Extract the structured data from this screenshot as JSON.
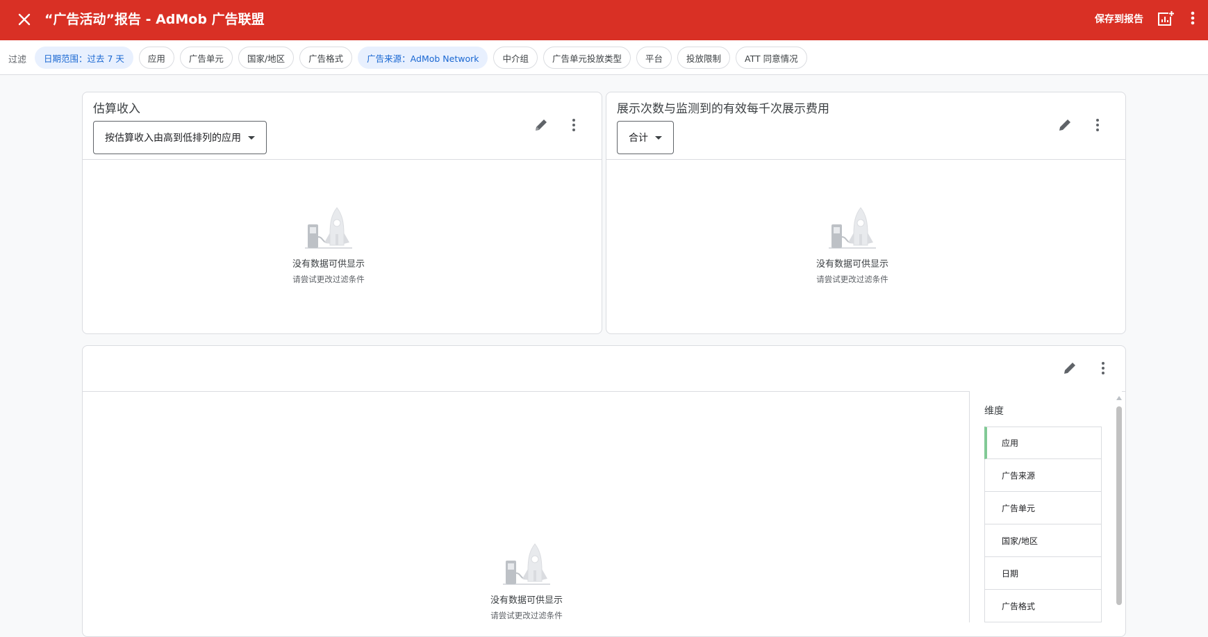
{
  "header": {
    "title": "“广告活动”报告 - AdMob 广告联盟",
    "save_label": "保存到报告",
    "close_icon": "close-icon",
    "add_chart_icon": "add-chart-icon",
    "more_icon": "more-vert-icon",
    "background": "#d93025"
  },
  "filters": {
    "label": "过滤",
    "chips": [
      {
        "label": "日期范围：过去 7 天",
        "active": true
      },
      {
        "label": "应用",
        "active": false
      },
      {
        "label": "广告单元",
        "active": false
      },
      {
        "label": "国家/地区",
        "active": false
      },
      {
        "label": "广告格式",
        "active": false
      },
      {
        "label": "广告来源：AdMob Network",
        "active": true
      },
      {
        "label": "中介组",
        "active": false
      },
      {
        "label": "广告单元投放类型",
        "active": false
      },
      {
        "label": "平台",
        "active": false
      },
      {
        "label": "投放限制",
        "active": false
      },
      {
        "label": "ATT 同意情况",
        "active": false
      }
    ]
  },
  "cards": {
    "revenue": {
      "title": "估算收入",
      "dropdown": "按估算收入由高到低排列的应用",
      "empty_title": "没有数据可供显示",
      "empty_sub": "请尝试更改过滤条件"
    },
    "impressions": {
      "title": "展示次数与监测到的有效每千次展示费用",
      "dropdown": "合计",
      "empty_title": "没有数据可供显示",
      "empty_sub": "请尝试更改过滤条件"
    },
    "table": {
      "empty_title": "没有数据可供显示",
      "empty_sub": "请尝试更改过滤条件"
    }
  },
  "dimensions": {
    "title": "维度",
    "items": [
      "应用",
      "广告来源",
      "广告单元",
      "国家/地区",
      "日期",
      "广告格式"
    ],
    "selected": "应用",
    "selected_color": "#81c995"
  }
}
